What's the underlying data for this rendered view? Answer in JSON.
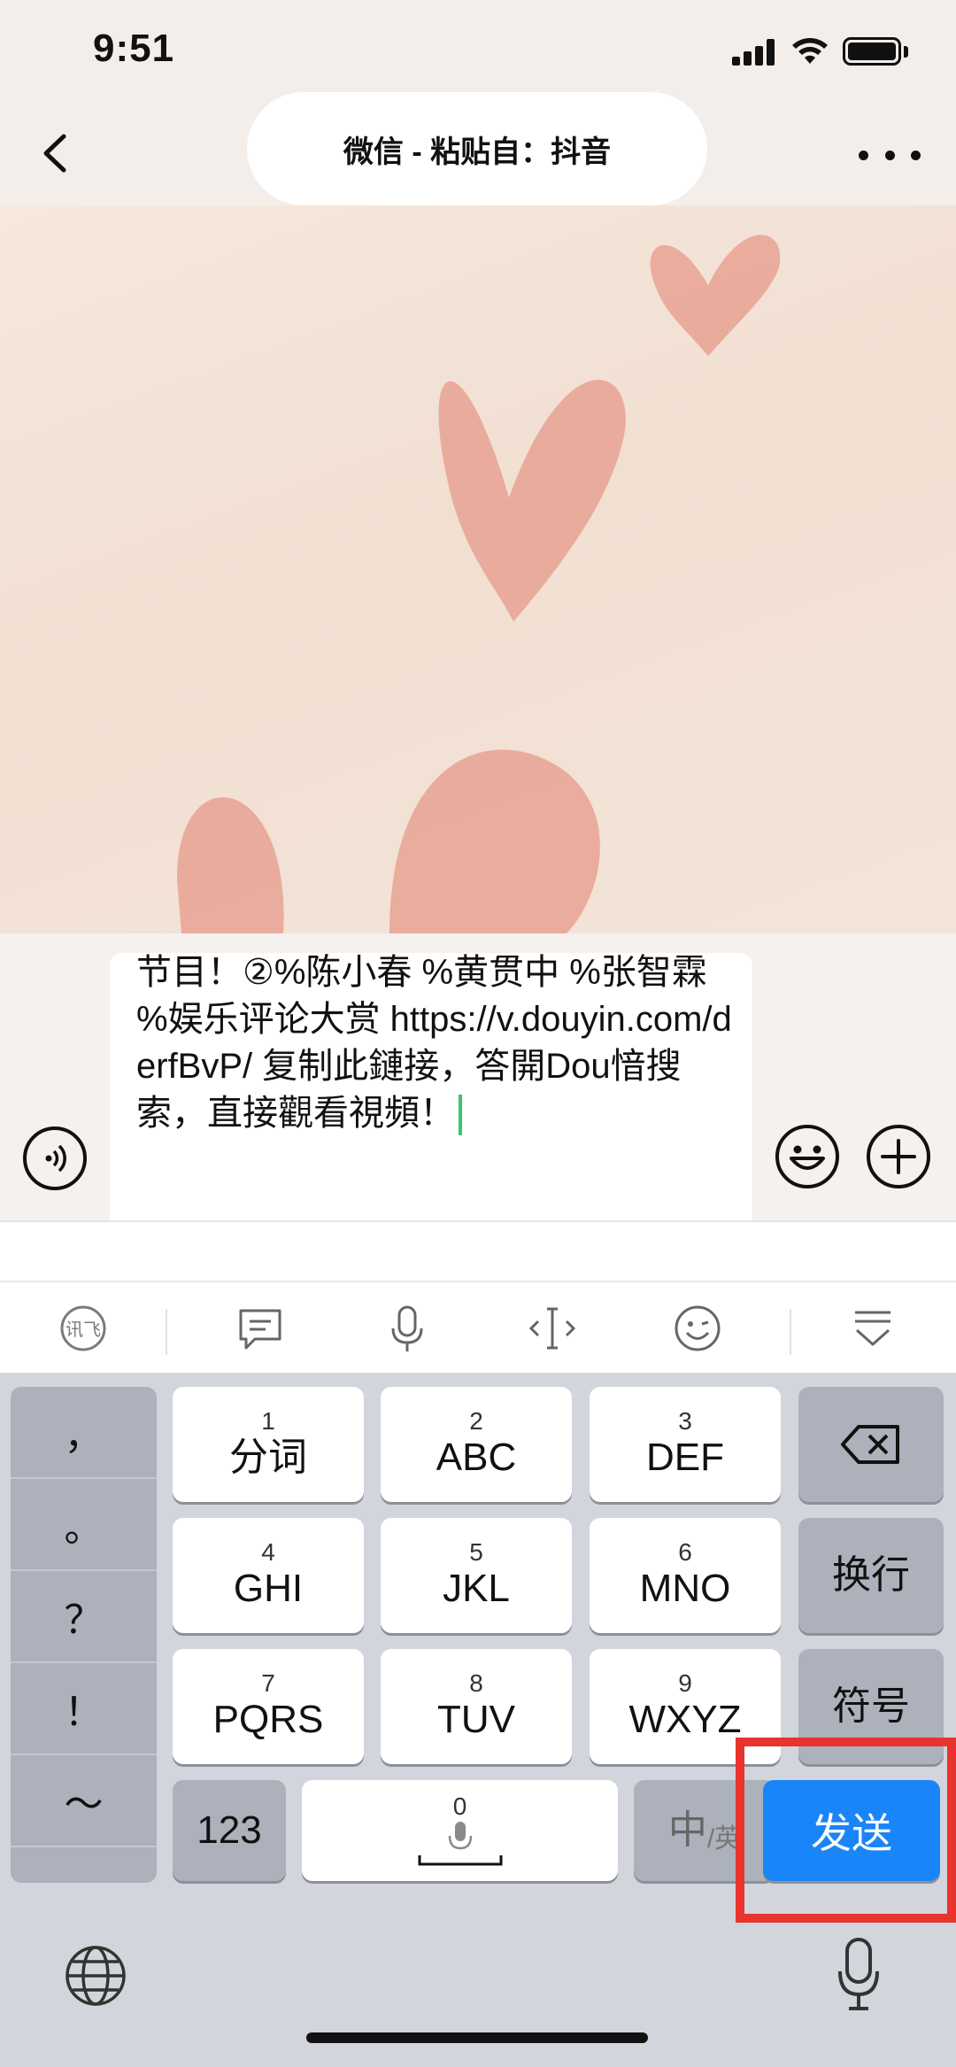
{
  "status": {
    "time": "9:51"
  },
  "nav": {
    "title": "微信 - 粘贴自：抖音"
  },
  "input": {
    "text": "节目！②%陈小春 %黄贯中 %张智霖 %娱乐评论大赏 https://v.douyin.com/derfBvP/ 复制此鏈接，答開Dou愔搜索，直接觀看視頻！"
  },
  "ime_toolbar": [
    "ime-logo-icon",
    "clipboard-icon",
    "microphone-icon",
    "cursor-icon",
    "emoji-icon",
    "collapse-keyboard-icon"
  ],
  "keyboard": {
    "punctuation": [
      "，",
      "。",
      "？",
      "！",
      "～"
    ],
    "keys": [
      {
        "num": "1",
        "label": "分词"
      },
      {
        "num": "2",
        "label": "ABC"
      },
      {
        "num": "3",
        "label": "DEF"
      },
      {
        "num": "4",
        "label": "GHI"
      },
      {
        "num": "5",
        "label": "JKL"
      },
      {
        "num": "6",
        "label": "MNO"
      },
      {
        "num": "7",
        "label": "PQRS"
      },
      {
        "num": "8",
        "label": "TUV"
      },
      {
        "num": "9",
        "label": "WXYZ"
      }
    ],
    "newline": "换行",
    "symbols": "符号",
    "num_switch": "123",
    "space_num": "0",
    "lang_main": "中",
    "lang_sub": "/英",
    "send": "发送"
  },
  "colors": {
    "send": "#1a85f8",
    "highlight": "#e8332e",
    "caret": "#39c66d"
  }
}
